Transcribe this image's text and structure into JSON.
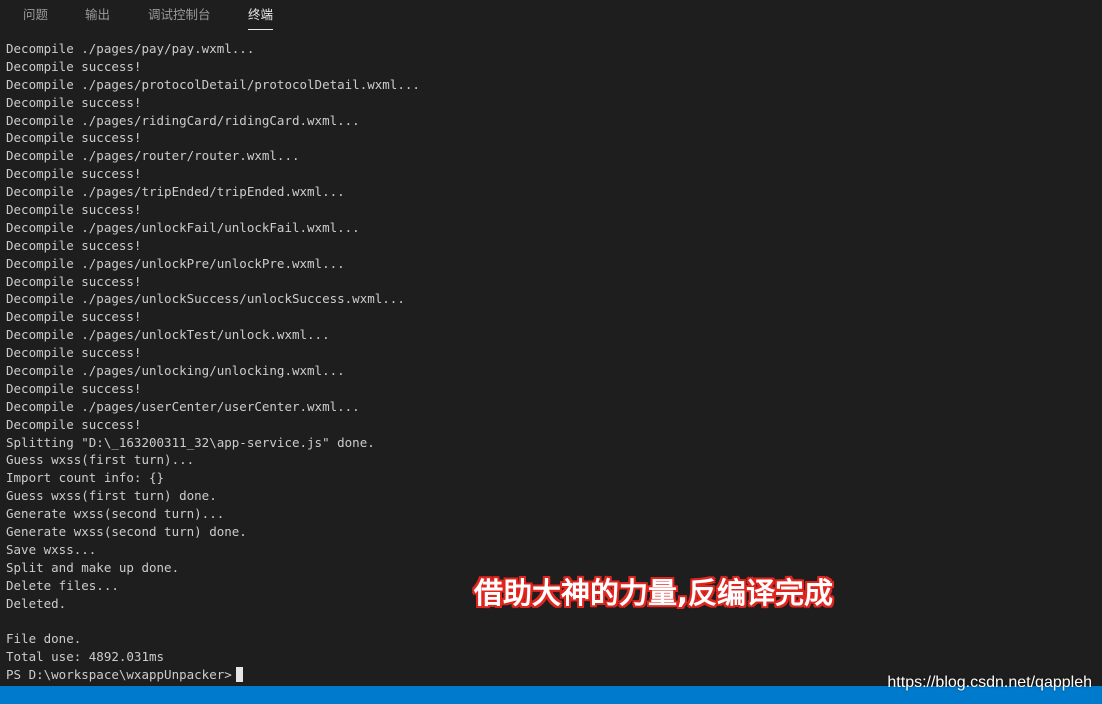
{
  "tabs": [
    {
      "label": "问题",
      "active": false
    },
    {
      "label": "输出",
      "active": false
    },
    {
      "label": "调试控制台",
      "active": false
    },
    {
      "label": "终端",
      "active": true
    }
  ],
  "terminal": {
    "lines": [
      "Decompile ./pages/pay/pay.wxml...",
      "Decompile success!",
      "Decompile ./pages/protocolDetail/protocolDetail.wxml...",
      "Decompile success!",
      "Decompile ./pages/ridingCard/ridingCard.wxml...",
      "Decompile success!",
      "Decompile ./pages/router/router.wxml...",
      "Decompile success!",
      "Decompile ./pages/tripEnded/tripEnded.wxml...",
      "Decompile success!",
      "Decompile ./pages/unlockFail/unlockFail.wxml...",
      "Decompile success!",
      "Decompile ./pages/unlockPre/unlockPre.wxml...",
      "Decompile success!",
      "Decompile ./pages/unlockSuccess/unlockSuccess.wxml...",
      "Decompile success!",
      "Decompile ./pages/unlockTest/unlock.wxml...",
      "Decompile success!",
      "Decompile ./pages/unlocking/unlocking.wxml...",
      "Decompile success!",
      "Decompile ./pages/userCenter/userCenter.wxml...",
      "Decompile success!",
      "Splitting \"D:\\_163200311_32\\app-service.js\" done.",
      "Guess wxss(first turn)...",
      "Import count info: {}",
      "Guess wxss(first turn) done.",
      "Generate wxss(second turn)...",
      "Generate wxss(second turn) done.",
      "Save wxss...",
      "Split and make up done.",
      "Delete files...",
      "Deleted.",
      "",
      "File done.",
      "Total use: 4892.031ms"
    ],
    "prompt": "PS D:\\workspace\\wxappUnpacker>"
  },
  "overlay_caption": "借助大神的力量,反编译完成",
  "watermark": "https://blog.csdn.net/qappleh",
  "colors": {
    "background": "#1e1e1e",
    "text": "#cccccc",
    "statusbar": "#007acc",
    "caption_outline": "#e0251f"
  }
}
